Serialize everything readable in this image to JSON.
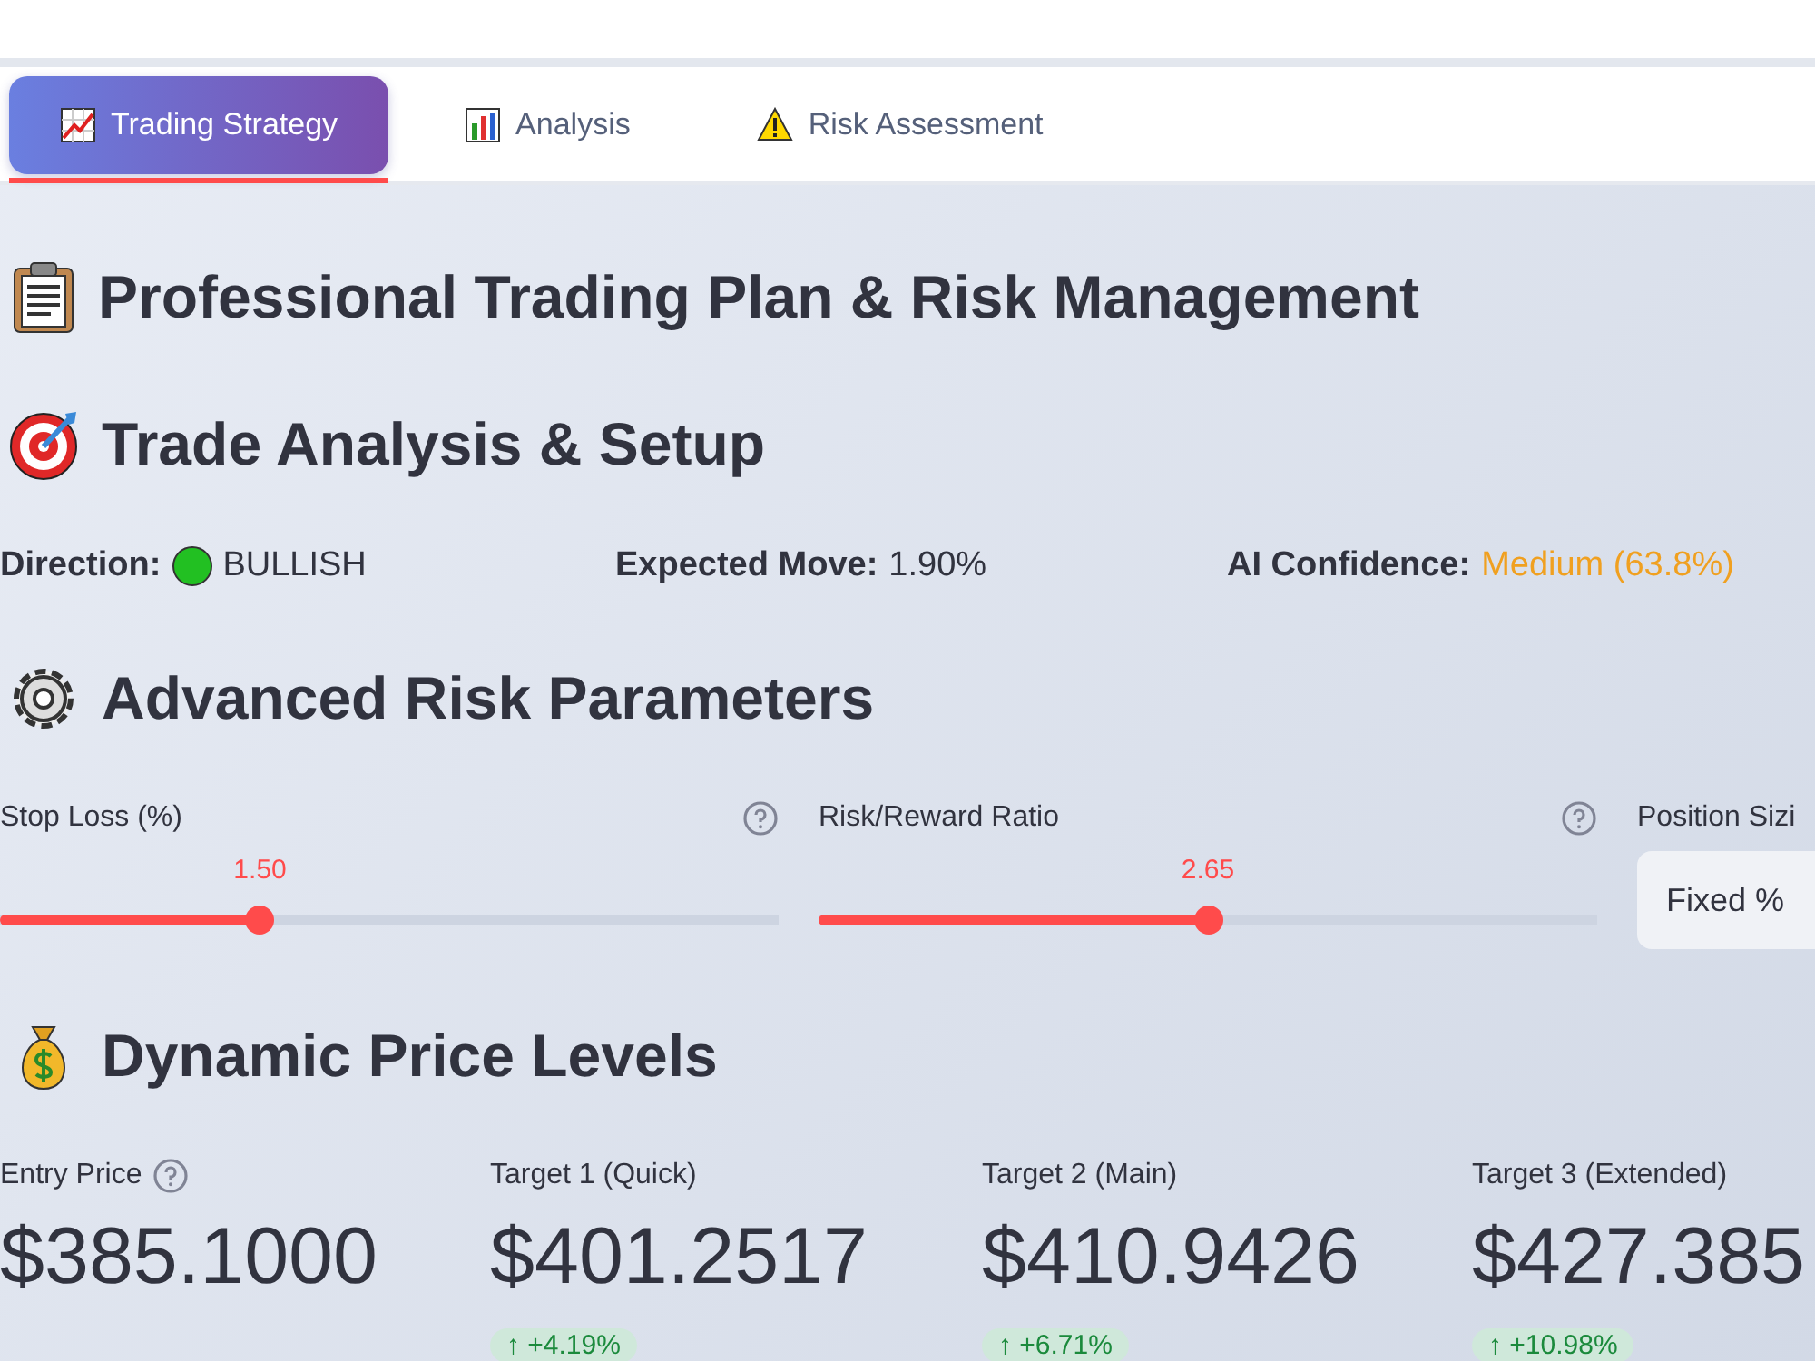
{
  "tabs": [
    {
      "label": "Trading Strategy",
      "selected": true
    },
    {
      "label": "Analysis",
      "selected": false
    },
    {
      "label": "Risk Assessment",
      "selected": false
    }
  ],
  "title": {
    "text": "Professional Trading Plan & Risk Management"
  },
  "trade_section": {
    "heading": "Trade Analysis & Setup",
    "metrics": [
      {
        "kind": "status",
        "label": "Direction:",
        "value": "BULLISH",
        "color": "#22c022"
      },
      {
        "kind": "plain",
        "label": "Expected Move:",
        "value": "1.90%"
      },
      {
        "kind": "highlight",
        "label": "AI Confidence:",
        "value": "Medium (63.8%)",
        "color": "#f0a020"
      }
    ]
  },
  "risk_section": {
    "heading": "Advanced Risk Parameters",
    "sliders": [
      {
        "label": "Stop Loss (%)",
        "reading": "1.50",
        "level": 0.334
      },
      {
        "label": "Risk/Reward Ratio",
        "reading": "2.65",
        "level": 0.5
      }
    ],
    "select": {
      "label": "Position Sizi",
      "value": "Fixed %"
    }
  },
  "price_section": {
    "heading": "Dynamic Price Levels",
    "levels": [
      {
        "label": "Entry Price",
        "help": true,
        "value": "$385.1000"
      },
      {
        "label": "Target 1 (Quick)",
        "value": "$401.2517",
        "delta": "↑ +4.19%"
      },
      {
        "label": "Target 2 (Main)",
        "value": "$410.9426",
        "delta": "↑ +6.71%"
      },
      {
        "label": "Target 3 (Extended)",
        "value": "$427.385",
        "delta": "↑ +10.98%"
      }
    ]
  }
}
